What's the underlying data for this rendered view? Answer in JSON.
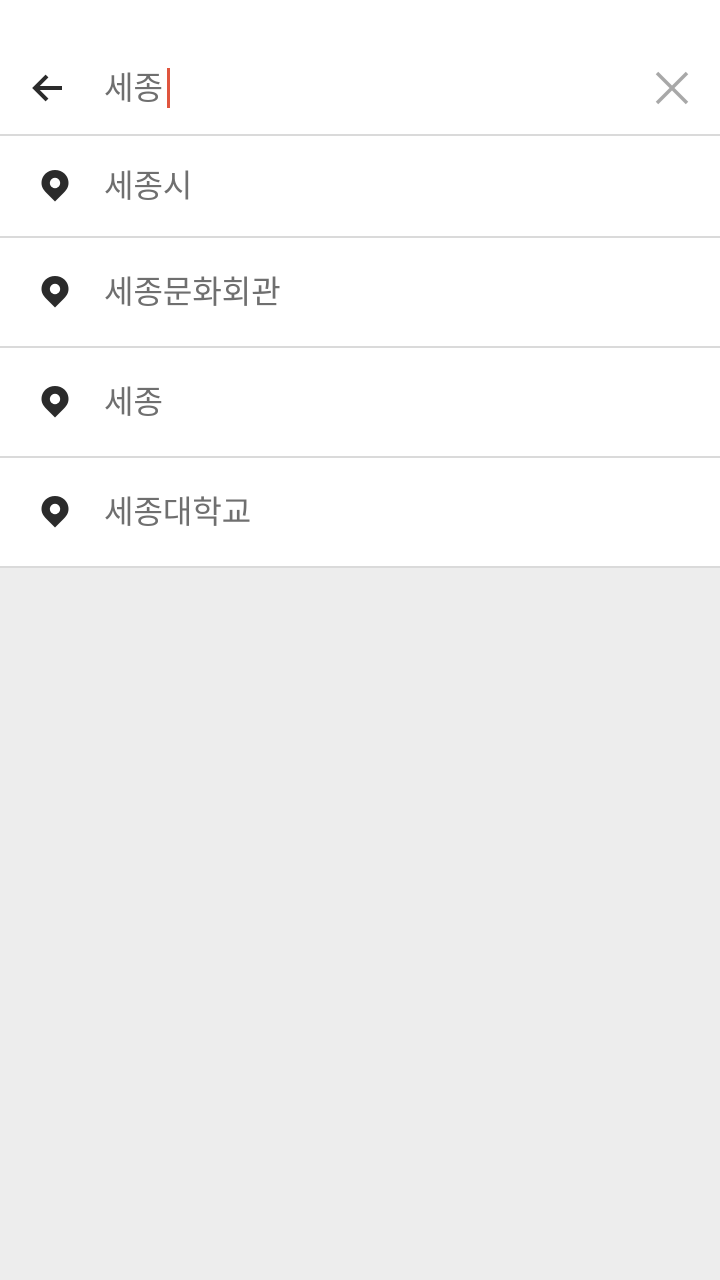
{
  "search": {
    "query": "세종",
    "back_icon": "arrow-left-icon",
    "clear_icon": "close-icon"
  },
  "suggestions": [
    {
      "label": "세종시",
      "icon": "location-pin-icon"
    },
    {
      "label": "세종문화회관",
      "icon": "location-pin-icon"
    },
    {
      "label": "세종",
      "icon": "location-pin-icon"
    },
    {
      "label": "세종대학교",
      "icon": "location-pin-icon"
    }
  ],
  "colors": {
    "caret": "#e0553e",
    "text": "#6f6f6f",
    "icon": "#2b2b2b",
    "divider": "#dadada",
    "background": "#ededed"
  }
}
